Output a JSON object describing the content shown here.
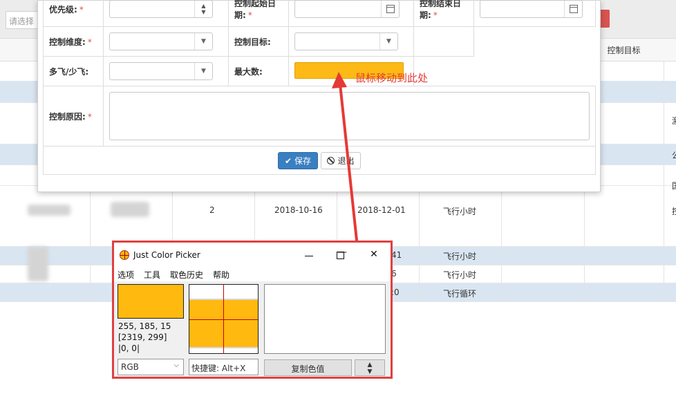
{
  "background": {
    "filter_placeholder": "请选择",
    "header_right_column": "控制目标",
    "row1": {
      "number": "2",
      "start_date": "2018-10-16",
      "end_date": "2018-12-01",
      "target": "飞行小时"
    },
    "row2": {
      "end_date_fragment": "41",
      "target": "飞行小时"
    },
    "row3": {
      "end_date_fragment": "6",
      "target": "飞行小时"
    },
    "row4": {
      "end_date_fragment": ":0",
      "target": "飞行循环"
    },
    "edge_chars": [
      "激",
      "公",
      "国",
      "控"
    ]
  },
  "modal": {
    "priority_label": "优先级:",
    "start_date_label_1": "控制起始日",
    "start_date_label_2": "期:",
    "end_date_label_1": "控制结束日",
    "end_date_label_2": "期:",
    "dimension_label": "控制维度:",
    "target_label": "控制目标:",
    "more_less_label": "多飞/少飞:",
    "max_label": "最大数:",
    "reason_label": "控制原因:",
    "required_mark": "*",
    "save_label": "保存",
    "exit_label": "退出"
  },
  "annotation": "鼠标移动到此处",
  "picker": {
    "title": "Just Color Picker",
    "menu": [
      "选项",
      "工具",
      "取色历史",
      "帮助"
    ],
    "rgb_value": "255, 185, 15",
    "screen_position": "[2319, 299]",
    "offset": "|0, 0|",
    "mode": "RGB",
    "hotkey": "快捷键: Alt+X",
    "copy_button": "复制色值",
    "color": "#ffb90f"
  }
}
